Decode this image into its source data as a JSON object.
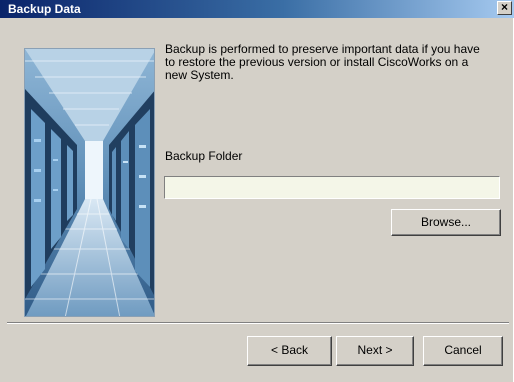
{
  "window": {
    "title": "Backup Data",
    "close_glyph": "×"
  },
  "content": {
    "description": "Backup is performed to preserve important data if you have to restore the previous version or install CiscoWorks on a new System.",
    "folder_label": "Backup Folder",
    "folder_value": "",
    "browse_label": "Browse..."
  },
  "footer": {
    "back_label": "< Back",
    "next_label": "Next >",
    "cancel_label": "Cancel"
  },
  "icons": {
    "side_image": "server-room-illustration",
    "close": "close-icon"
  }
}
